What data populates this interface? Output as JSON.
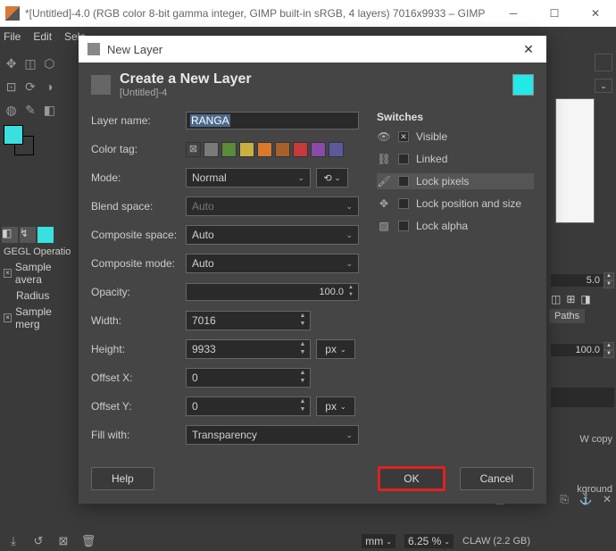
{
  "window": {
    "title": "*[Untitled]-4.0 (RGB color 8-bit gamma integer, GIMP built-in sRGB, 4 layers) 7016x9933 – GIMP",
    "app": "GIMP"
  },
  "menu": {
    "file": "File",
    "edit": "Edit",
    "select": "Sele"
  },
  "gegl": {
    "title": "GEGL Operatio",
    "sample_avg": "Sample avera",
    "radius": "Radius",
    "sample_merged": "Sample merg"
  },
  "right": {
    "spin1": "5.0",
    "tab_paths": "Paths",
    "spin2": "100.0",
    "layer_copy": "W copy",
    "background": "kground"
  },
  "status": {
    "mm": "mm",
    "zoom": "6.25 %",
    "mem": "CLAW (2.2 GB)"
  },
  "dialog": {
    "title": "New Layer",
    "heading": "Create a New Layer",
    "subheading": "[Untitled]-4",
    "labels": {
      "layer_name": "Layer name:",
      "color_tag": "Color tag:",
      "mode": "Mode:",
      "blend_space": "Blend space:",
      "composite_space": "Composite space:",
      "composite_mode": "Composite mode:",
      "opacity": "Opacity:",
      "width": "Width:",
      "height": "Height:",
      "offset_x": "Offset X:",
      "offset_y": "Offset Y:",
      "fill_with": "Fill with:"
    },
    "values": {
      "layer_name": "RANGA",
      "mode": "Normal",
      "blend_space": "Auto",
      "composite_space": "Auto",
      "composite_mode": "Auto",
      "opacity": "100.0",
      "width": "7016",
      "height": "9933",
      "offset_x": "0",
      "offset_y": "0",
      "fill_with": "Transparency",
      "unit": "px"
    },
    "color_tags": [
      "#888888",
      "#7a7a7a",
      "#5a8a3a",
      "#c8b040",
      "#d87a2a",
      "#a8602a",
      "#c83a3a",
      "#8a4aa8",
      "#5a5a9a"
    ],
    "switches": {
      "title": "Switches",
      "visible": "Visible",
      "linked": "Linked",
      "lock_pixels": "Lock pixels",
      "lock_position": "Lock position and size",
      "lock_alpha": "Lock alpha",
      "visible_checked": true
    },
    "buttons": {
      "help": "Help",
      "ok": "OK",
      "cancel": "Cancel"
    }
  }
}
